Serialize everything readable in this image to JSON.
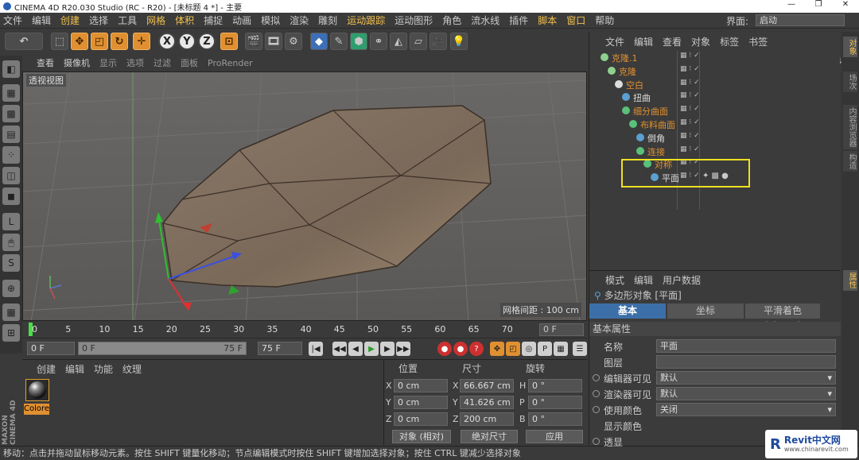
{
  "window": {
    "title": "CINEMA 4D R20.030 Studio (RC - R20) - [未标题 4 *] - 主要",
    "controls": [
      "—",
      "❐",
      "✕"
    ]
  },
  "menubar": {
    "items": [
      {
        "label": "文件",
        "hl": false
      },
      {
        "label": "编辑",
        "hl": false
      },
      {
        "label": "创建",
        "hl": true
      },
      {
        "label": "选择",
        "hl": false
      },
      {
        "label": "工具",
        "hl": false
      },
      {
        "label": "网格",
        "hl": true
      },
      {
        "label": "体积",
        "hl": true
      },
      {
        "label": "捕捉",
        "hl": false
      },
      {
        "label": "动画",
        "hl": false
      },
      {
        "label": "模拟",
        "hl": false
      },
      {
        "label": "渲染",
        "hl": false
      },
      {
        "label": "雕刻",
        "hl": false
      },
      {
        "label": "运动跟踪",
        "hl": true
      },
      {
        "label": "运动图形",
        "hl": false
      },
      {
        "label": "角色",
        "hl": false
      },
      {
        "label": "流水线",
        "hl": false
      },
      {
        "label": "插件",
        "hl": false
      },
      {
        "label": "脚本",
        "hl": true
      },
      {
        "label": "窗口",
        "hl": true
      },
      {
        "label": "帮助",
        "hl": false
      }
    ],
    "layout_label": "界面:",
    "layout_value": "启动"
  },
  "toolbar": {
    "undo_icon": "↶",
    "axis_labels": [
      "X",
      "Y",
      "Z"
    ]
  },
  "viewport": {
    "menu": [
      {
        "label": "查看",
        "dim": false
      },
      {
        "label": "摄像机",
        "dim": false
      },
      {
        "label": "显示",
        "dim": true
      },
      {
        "label": "选项",
        "dim": true
      },
      {
        "label": "过滤",
        "dim": true
      },
      {
        "label": "面板",
        "dim": true
      },
      {
        "label": "ProRender",
        "dim": true
      }
    ],
    "nav_icons": "✥↓⟳▣",
    "label": "透视视图",
    "grid_spacing": "网格间距 : 100 cm"
  },
  "timeline": {
    "ticks": [
      "0",
      "5",
      "10",
      "15",
      "20",
      "25",
      "30",
      "35",
      "40",
      "45",
      "50",
      "55",
      "60",
      "65",
      "70"
    ],
    "current_frame": "0 F"
  },
  "playback": {
    "start": "0 F",
    "range_start": "0 F",
    "range_end": "75 F",
    "end": "75 F"
  },
  "materials": {
    "menu": [
      "创建",
      "编辑",
      "功能",
      "纹理"
    ],
    "material_name": "Colore"
  },
  "coords": {
    "headers": [
      "位置",
      "尺寸",
      "旋转"
    ],
    "rows": [
      {
        "axis": "X",
        "pos": "0 cm",
        "size_axis": "X",
        "size": "66.667 cm",
        "rot_axis": "H",
        "rot": "0 °"
      },
      {
        "axis": "Y",
        "pos": "0 cm",
        "size_axis": "Y",
        "size": "41.626 cm",
        "rot_axis": "P",
        "rot": "0 °"
      },
      {
        "axis": "Z",
        "pos": "0 cm",
        "size_axis": "Z",
        "size": "200 cm",
        "rot_axis": "B",
        "rot": "0 °"
      }
    ],
    "mode": "对象 (相对)",
    "size_mode": "绝对尺寸",
    "apply": "应用"
  },
  "branding": "MAXON CINEMA 4D",
  "status": "移动：点击并拖动鼠标移动元素。按住 SHIFT 键量化移动；节点编辑模式时按住 SHIFT 键增加选择对象；按住 CTRL 键减少选择对象",
  "object_manager": {
    "menu": [
      "文件",
      "编辑",
      "查看",
      "对象",
      "标签",
      "书签"
    ],
    "objects": [
      {
        "name": "克隆.1",
        "indent": 0,
        "style": "orange"
      },
      {
        "name": "克隆",
        "indent": 1,
        "style": "orange"
      },
      {
        "name": "空白",
        "indent": 2,
        "style": "orange"
      },
      {
        "name": "扭曲",
        "indent": 3,
        "style": "white"
      },
      {
        "name": "细分曲面",
        "indent": 3,
        "style": "orange"
      },
      {
        "name": "布料曲面",
        "indent": 4,
        "style": "orange"
      },
      {
        "name": "倒角",
        "indent": 5,
        "style": "white"
      },
      {
        "name": "连接",
        "indent": 5,
        "style": "orange"
      },
      {
        "name": "对称",
        "indent": 6,
        "style": "orange"
      },
      {
        "name": "平面",
        "indent": 7,
        "style": "white"
      }
    ]
  },
  "attribute_manager": {
    "menu": [
      "模式",
      "编辑",
      "用户数据"
    ],
    "object": "多边形对象 [平面]",
    "tabs": [
      "基本",
      "坐标",
      "平滑着色(Phong)"
    ],
    "section": "基本属性",
    "fields": [
      {
        "label": "名称",
        "value": "平面",
        "radio": false,
        "dd": false
      },
      {
        "label": "图层",
        "value": "",
        "radio": false,
        "dd": false
      },
      {
        "label": "编辑器可见",
        "value": "默认",
        "radio": true,
        "dd": true
      },
      {
        "label": "渲染器可见",
        "value": "默认",
        "radio": true,
        "dd": true
      },
      {
        "label": "使用颜色",
        "value": "关闭",
        "radio": true,
        "dd": true
      },
      {
        "label": "显示颜色",
        "value": "",
        "radio": false,
        "dd": false
      },
      {
        "label": "透显",
        "value": "",
        "radio": true,
        "dd": false
      }
    ]
  },
  "right_tabs": [
    {
      "label": "对象",
      "hl": true
    },
    {
      "label": "场次",
      "hl": false
    },
    {
      "label": "内容浏览器",
      "hl": false
    },
    {
      "label": "构造",
      "hl": false
    },
    {
      "label": "属性",
      "hl": true
    }
  ],
  "watermark": {
    "brand": "Revit中文网",
    "url": "www.chinarevit.com"
  }
}
